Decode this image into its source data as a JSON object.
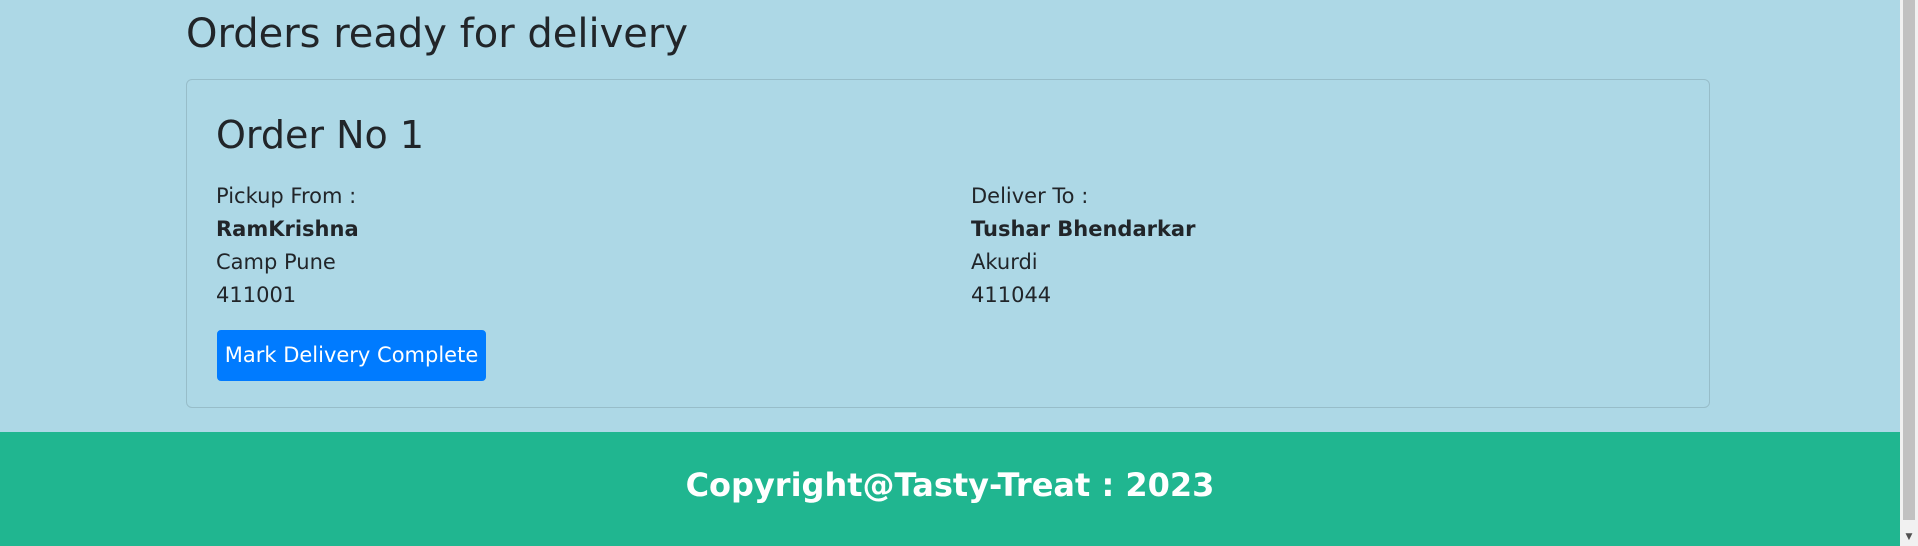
{
  "page": {
    "title": "Orders ready for delivery"
  },
  "order": {
    "title": "Order No 1",
    "pickup": {
      "label": "Pickup From :",
      "name": "RamKrishna",
      "address": "Camp Pune",
      "pincode": "411001"
    },
    "delivery": {
      "label": "Deliver To :",
      "name": "Tushar Bhendarkar",
      "address": "Akurdi",
      "pincode": "411044"
    },
    "action_label": "Mark Delivery Complete"
  },
  "footer": {
    "text": "Copyright@Tasty-Treat : 2023"
  },
  "colors": {
    "background": "#add8e6",
    "primary_button": "#007bff",
    "footer": "#20b690"
  },
  "icons": {
    "scroll_down": "scroll-down-arrow-icon"
  }
}
